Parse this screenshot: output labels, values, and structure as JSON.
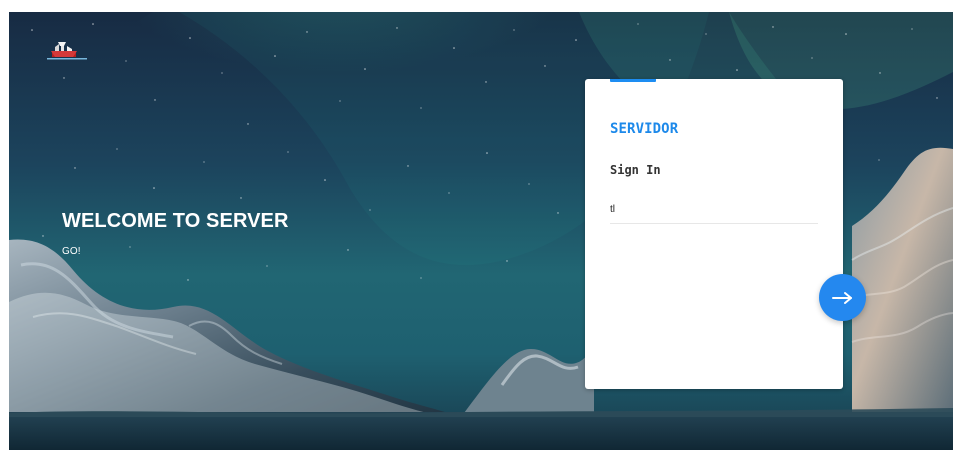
{
  "hero": {
    "title": "WELCOME TO SERVER",
    "subtitle": "GO!"
  },
  "login_card": {
    "brand": "SERVIDOR",
    "heading": "Sign In",
    "username_value": "tl",
    "submit_icon": "arrow-right-icon"
  },
  "logo": {
    "icon": "ship-logo-icon"
  },
  "colors": {
    "accent": "#1d89ea",
    "button": "#2488ef",
    "card": "#ffffff",
    "sky_dark": "#1a2f47",
    "aurora": "#35c08a"
  }
}
